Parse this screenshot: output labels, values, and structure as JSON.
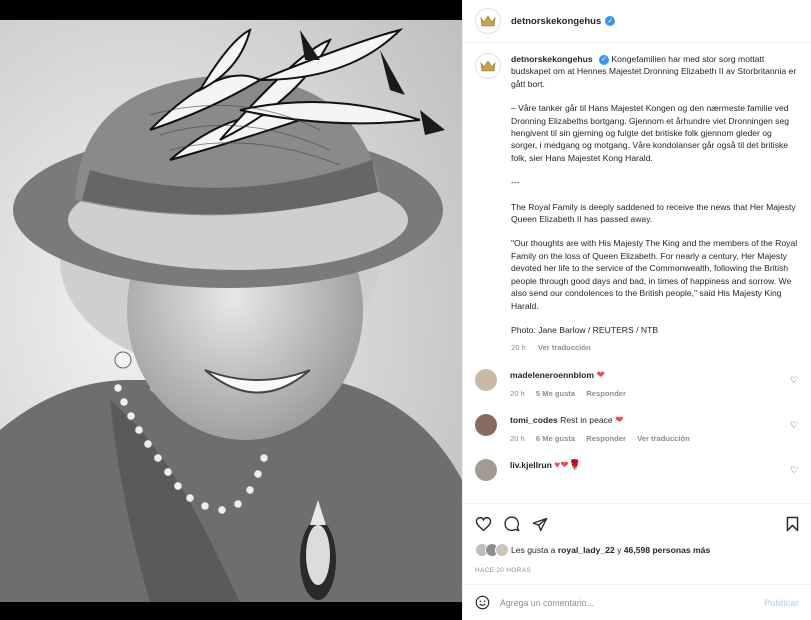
{
  "post": {
    "username": "detnorskekongehus",
    "caption": {
      "norwegian_1": "Kongefamilien har med stor sorg mottatt budskapet om at Hennes Majestet Dronning Elizabeth II av Storbritannia er gått bort.",
      "norwegian_2": "– Våre tanker går til Hans Majestet Kongen og den nærmeste familie ved Dronning Elizabeths bortgang. Gjennom et århundre viet Dronningen seg hengivent til sin gjerning og fulgte det britiske folk gjennom gleder og sorger, i medgang og motgang. Våre kondolanser går også til det britiske folk, sier Hans Majestet Kong Harald.",
      "separator": "---",
      "english_1": "The Royal Family is deeply saddened to receive the news that Her Majesty Queen Elizabeth II has passed away.",
      "english_2": "\"Our thoughts are with His Majesty The King and the members of the Royal Family on the loss of Queen Elizabeth. For nearly a century, Her Majesty devoted her life to the service of the Commonwealth, following the British people through good days and bad, in times of happiness and sorrow. We also send our condolences to the British people,\" said His Majesty King Harald.",
      "credit": "Photo: Jane Barlow / REUTERS / NTB"
    },
    "caption_time": "20 h",
    "see_translation": "Ver traducción"
  },
  "comments": [
    {
      "user": "madeleneroennblom",
      "text": "",
      "emoji": "❤",
      "time": "20 h",
      "likes": "5 Me gusta",
      "reply": "Responder",
      "translate": "",
      "avatar_color": "#c9b9a7"
    },
    {
      "user": "tomi_codes",
      "text": "Rest in peace",
      "emoji": "❤",
      "time": "20 h",
      "likes": "6 Me gusta",
      "reply": "Responder",
      "translate": "Ver traducción",
      "avatar_color": "#8a6a5c"
    },
    {
      "user": "liv.kjellrun",
      "text": "",
      "emoji": "♥❤🌹",
      "time": "",
      "likes": "",
      "reply": "",
      "translate": "",
      "avatar_color": "#a39a92"
    }
  ],
  "likes_line": {
    "prefix": "Les gusta a",
    "user": "royal_lady_22",
    "joiner": "y",
    "count": "46,598 personas más"
  },
  "time_ago": "HACE 20 HORAS",
  "add_comment": {
    "placeholder": "Agrega un comentario...",
    "post_label": "Publicar"
  },
  "colors": {
    "verified": "#3897f0",
    "heart": "#ed4956",
    "muted": "#8e8e8e",
    "publish_disabled": "#b2dffc"
  },
  "icons": [
    "crown-icon",
    "verified-icon",
    "more-icon",
    "heart-icon",
    "comment-icon",
    "share-icon",
    "bookmark-icon",
    "emoji-icon"
  ]
}
